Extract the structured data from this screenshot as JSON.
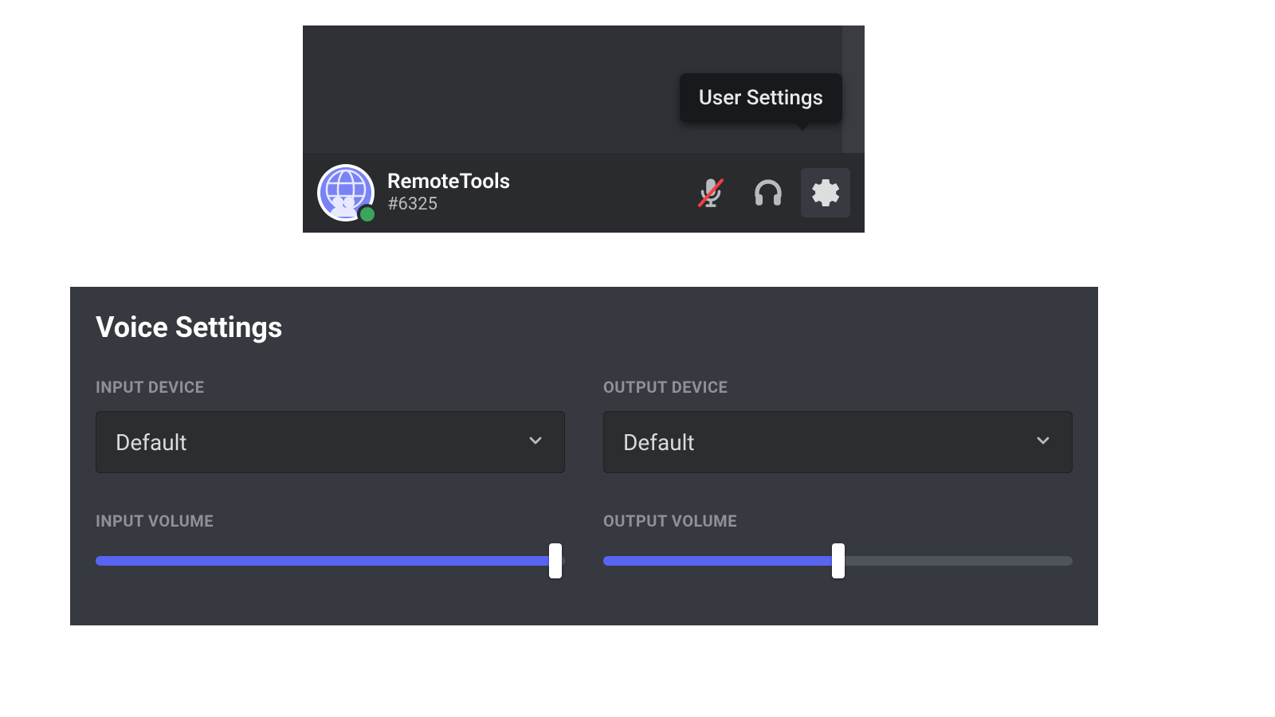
{
  "user_panel": {
    "username": "RemoteTools",
    "discriminator": "#6325",
    "tooltip": "User Settings",
    "status": "online"
  },
  "voice_settings": {
    "title": "Voice Settings",
    "input_device": {
      "label": "INPUT DEVICE",
      "value": "Default"
    },
    "output_device": {
      "label": "OUTPUT DEVICE",
      "value": "Default"
    },
    "input_volume": {
      "label": "INPUT VOLUME",
      "percent": 98
    },
    "output_volume": {
      "label": "OUTPUT VOLUME",
      "percent": 50
    }
  }
}
